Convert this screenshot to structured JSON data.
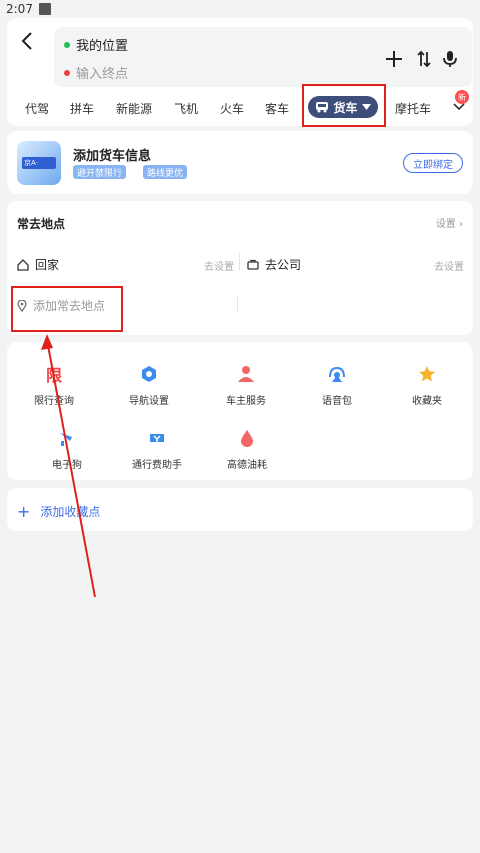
{
  "status_bar": {
    "time": "2:07"
  },
  "route": {
    "start": "我的位置",
    "end_placeholder": "输入终点"
  },
  "transport_tabs": [
    {
      "label": "代驾"
    },
    {
      "label": "拼车"
    },
    {
      "label": "新能源"
    },
    {
      "label": "飞机"
    },
    {
      "label": "火车"
    },
    {
      "label": "客车"
    },
    {
      "label": "货车",
      "selected": true
    },
    {
      "label": "摩托车"
    }
  ],
  "new_badge": "新",
  "truck_card": {
    "title": "添加货车信息",
    "tags": [
      "避开禁限行",
      "路线更优"
    ],
    "bind_button": "立即绑定",
    "plate_text": "京A·"
  },
  "frequent": {
    "title": "常去地点",
    "settings": "设置",
    "home": "回家",
    "home_set": "去设置",
    "company": "去公司",
    "company_set": "去设置",
    "add_place": "添加常去地点"
  },
  "tools": [
    {
      "label": "限行查询",
      "icon": "limit-icon",
      "glyph": "限"
    },
    {
      "label": "导航设置",
      "icon": "nav-settings-icon"
    },
    {
      "label": "车主服务",
      "icon": "owner-service-icon"
    },
    {
      "label": "语音包",
      "icon": "voice-pack-icon"
    },
    {
      "label": "收藏夹",
      "icon": "favorites-star-icon"
    },
    {
      "label": "电子狗",
      "icon": "electronic-dog-icon"
    },
    {
      "label": "通行费助手",
      "icon": "toll-assistant-icon"
    },
    {
      "label": "高德油耗",
      "icon": "fuel-drop-icon"
    }
  ],
  "favorite": {
    "label": "添加收藏点"
  },
  "colors": {
    "accent": "#3c6de8",
    "truck_tab": "#3d4e7a",
    "highlight": "#e0201c",
    "start_dot": "#1fbf55",
    "end_dot": "#f04141"
  }
}
